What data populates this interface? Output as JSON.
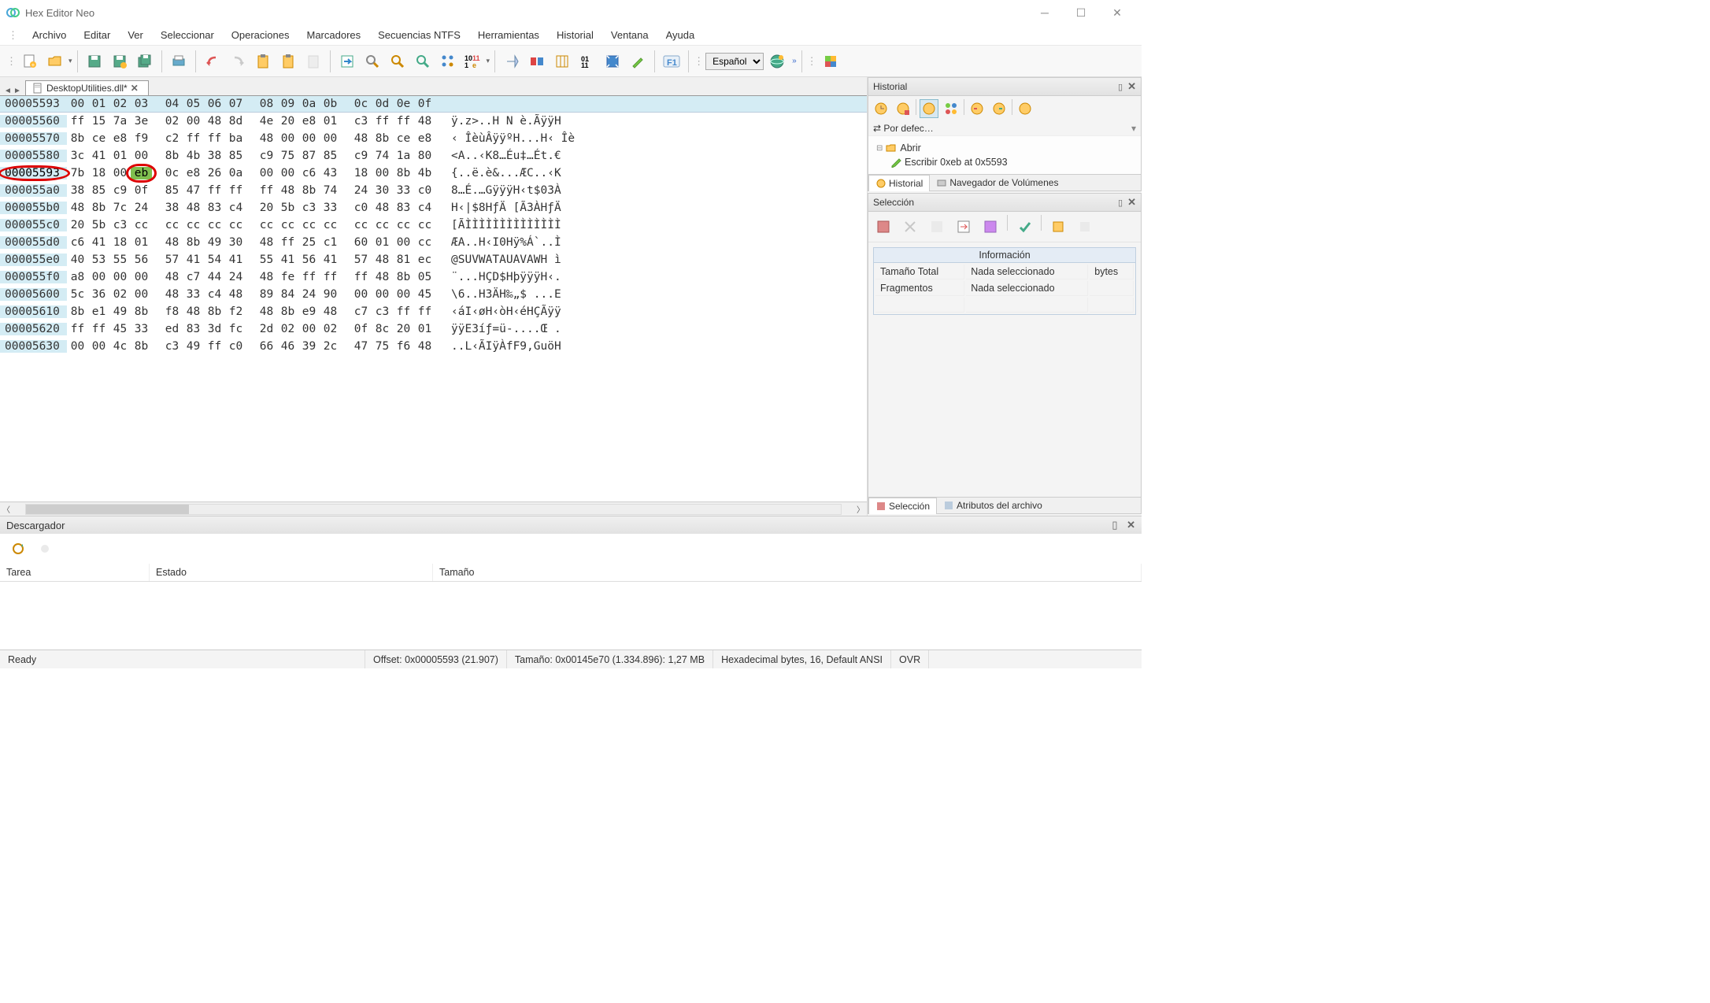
{
  "window": {
    "title": "Hex Editor Neo"
  },
  "menu": [
    "Archivo",
    "Editar",
    "Ver",
    "Seleccionar",
    "Operaciones",
    "Marcadores",
    "Secuencias NTFS",
    "Herramientas",
    "Historial",
    "Ventana",
    "Ayuda"
  ],
  "toolbar": {
    "language": "Español"
  },
  "tab": {
    "filename": "DesktopUtilities.dll*"
  },
  "hex": {
    "header_offset": "00005593",
    "columns": [
      "00",
      "01",
      "02",
      "03",
      "04",
      "05",
      "06",
      "07",
      "08",
      "09",
      "0a",
      "0b",
      "0c",
      "0d",
      "0e",
      "0f"
    ],
    "rows": [
      {
        "off": "00005560",
        "bytes": [
          "ff",
          "15",
          "7a",
          "3e",
          "02",
          "00",
          "48",
          "8d",
          "4e",
          "20",
          "e8",
          "01",
          "c3",
          "ff",
          "ff",
          "48"
        ],
        "ascii": "ÿ.z>..H N è.ÃÿÿH",
        "hl": false
      },
      {
        "off": "00005570",
        "bytes": [
          "8b",
          "ce",
          "e8",
          "f9",
          "c2",
          "ff",
          "ff",
          "ba",
          "48",
          "00",
          "00",
          "00",
          "48",
          "8b",
          "ce",
          "e8"
        ],
        "ascii": "‹ ÎèùÂÿÿºH...H‹ Îè",
        "hl": false
      },
      {
        "off": "00005580",
        "bytes": [
          "3c",
          "41",
          "01",
          "00",
          "8b",
          "4b",
          "38",
          "85",
          "c9",
          "75",
          "87",
          "85",
          "c9",
          "74",
          "1a",
          "80"
        ],
        "ascii": "<A..‹K8…Éu‡…Ét.€",
        "hl": false
      },
      {
        "off": "00005593",
        "bytes": [
          "7b",
          "18",
          "00",
          "eb",
          "0c",
          "e8",
          "26",
          "0a",
          "00",
          "00",
          "c6",
          "43",
          "18",
          "00",
          "8b",
          "4b"
        ],
        "ascii": "{..ë.è&...ÆC..‹K",
        "hl": true,
        "edited": 3
      },
      {
        "off": "000055a0",
        "bytes": [
          "38",
          "85",
          "c9",
          "0f",
          "85",
          "47",
          "ff",
          "ff",
          "ff",
          "48",
          "8b",
          "74",
          "24",
          "30",
          "33",
          "c0"
        ],
        "ascii": "8…É.…GÿÿÿH‹t$03À",
        "hl": false
      },
      {
        "off": "000055b0",
        "bytes": [
          "48",
          "8b",
          "7c",
          "24",
          "38",
          "48",
          "83",
          "c4",
          "20",
          "5b",
          "c3",
          "33",
          "c0",
          "48",
          "83",
          "c4"
        ],
        "ascii": "H‹|$8HƒÄ [Ã3ÀHƒÄ",
        "hl": false
      },
      {
        "off": "000055c0",
        "bytes": [
          "20",
          "5b",
          "c3",
          "cc",
          "cc",
          "cc",
          "cc",
          "cc",
          "cc",
          "cc",
          "cc",
          "cc",
          "cc",
          "cc",
          "cc",
          "cc"
        ],
        "ascii": "[ÃÌÌÌÌÌÌÌÌÌÌÌÌÌÌ",
        "hl": false
      },
      {
        "off": "000055d0",
        "bytes": [
          "c6",
          "41",
          "18",
          "01",
          "48",
          "8b",
          "49",
          "30",
          "48",
          "ff",
          "25",
          "c1",
          "60",
          "01",
          "00",
          "cc"
        ],
        "ascii": "ÆA..H‹I0Hÿ%Á`..Ì",
        "hl": false
      },
      {
        "off": "000055e0",
        "bytes": [
          "40",
          "53",
          "55",
          "56",
          "57",
          "41",
          "54",
          "41",
          "55",
          "41",
          "56",
          "41",
          "57",
          "48",
          "81",
          "ec"
        ],
        "ascii": "@SUVWATAUAVAWH ì",
        "hl": false
      },
      {
        "off": "000055f0",
        "bytes": [
          "a8",
          "00",
          "00",
          "00",
          "48",
          "c7",
          "44",
          "24",
          "48",
          "fe",
          "ff",
          "ff",
          "ff",
          "48",
          "8b",
          "05"
        ],
        "ascii": "¨...HÇD$HþÿÿÿH‹.",
        "hl": false
      },
      {
        "off": "00005600",
        "bytes": [
          "5c",
          "36",
          "02",
          "00",
          "48",
          "33",
          "c4",
          "48",
          "89",
          "84",
          "24",
          "90",
          "00",
          "00",
          "00",
          "45"
        ],
        "ascii": "\\6..H3ÄH‰„$ ...E",
        "hl": false
      },
      {
        "off": "00005610",
        "bytes": [
          "8b",
          "e1",
          "49",
          "8b",
          "f8",
          "48",
          "8b",
          "f2",
          "48",
          "8b",
          "e9",
          "48",
          "c7",
          "c3",
          "ff",
          "ff"
        ],
        "ascii": "‹áI‹øH‹òH‹éHÇÃÿÿ",
        "hl": false
      },
      {
        "off": "00005620",
        "bytes": [
          "ff",
          "ff",
          "45",
          "33",
          "ed",
          "83",
          "3d",
          "fc",
          "2d",
          "02",
          "00",
          "02",
          "0f",
          "8c",
          "20",
          "01"
        ],
        "ascii": "ÿÿE3íƒ=ü-....Œ .",
        "hl": false
      },
      {
        "off": "00005630",
        "bytes": [
          "00",
          "00",
          "4c",
          "8b",
          "c3",
          "49",
          "ff",
          "c0",
          "66",
          "46",
          "39",
          "2c",
          "47",
          "75",
          "f6",
          "48"
        ],
        "ascii": "..L‹ÃIÿÀfF9,GuöH",
        "hl": false
      }
    ]
  },
  "history": {
    "title": "Historial",
    "default_label": "⇄ Por defec…",
    "items": {
      "open": "Abrir",
      "write": "Escribir 0xeb at 0x5593"
    },
    "tabs": {
      "history": "Historial",
      "volumes": "Navegador de Volúmenes"
    }
  },
  "selection": {
    "title": "Selección",
    "info_label": "Información",
    "rows": [
      {
        "k": "Tamaño Total",
        "v": "Nada seleccionado",
        "u": "bytes"
      },
      {
        "k": "Fragmentos",
        "v": "Nada seleccionado",
        "u": ""
      }
    ],
    "tabs": {
      "sel": "Selección",
      "attr": "Atributos del archivo"
    }
  },
  "downloader": {
    "title": "Descargador",
    "columns": {
      "task": "Tarea",
      "state": "Estado",
      "size": "Tamaño"
    }
  },
  "status": {
    "ready": "Ready",
    "offset": "Offset: 0x00005593 (21.907)",
    "size": "Tamaño: 0x00145e70 (1.334.896): 1,27 MB",
    "mode": "Hexadecimal bytes, 16, Default ANSI",
    "ovr": "OVR"
  }
}
